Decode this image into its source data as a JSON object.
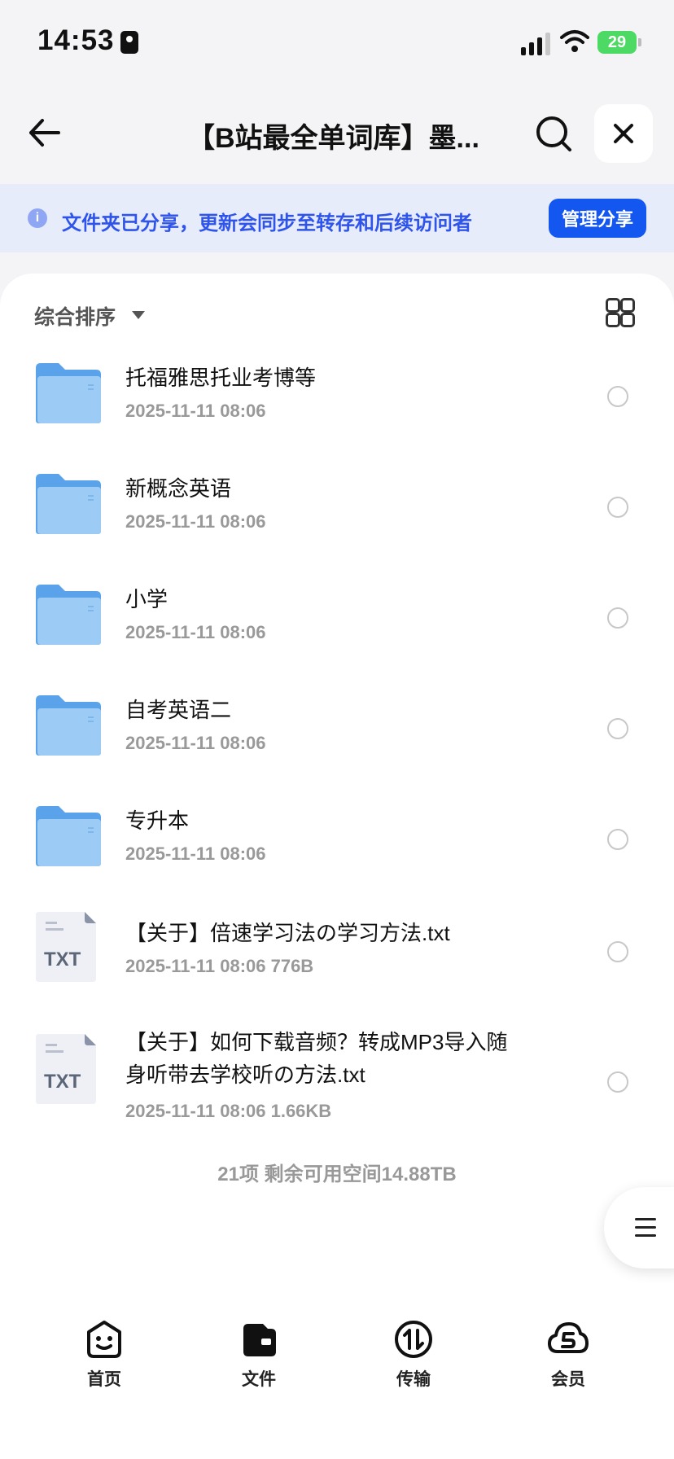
{
  "status_bar": {
    "time": "14:53",
    "battery": "29"
  },
  "header": {
    "title": "【B站最全单词库】墨..."
  },
  "banner": {
    "text": "文件夹已分享，更新会同步至转存和后续访问者",
    "manage_label": "管理分享"
  },
  "sort": {
    "label": "综合排序"
  },
  "files": [
    {
      "type": "folder",
      "name": "托福雅思托业考博等",
      "meta": "2025-11-11 08:06"
    },
    {
      "type": "folder",
      "name": "新概念英语",
      "meta": "2025-11-11 08:06"
    },
    {
      "type": "folder",
      "name": "小学",
      "meta": "2025-11-11 08:06"
    },
    {
      "type": "folder",
      "name": "自考英语二",
      "meta": "2025-11-11 08:06"
    },
    {
      "type": "folder",
      "name": "专升本",
      "meta": "2025-11-11 08:06"
    },
    {
      "type": "txt",
      "icon_label": "TXT",
      "name": "【关于】倍速学习法の学习方法.txt",
      "meta": "2025-11-11 08:06  776B"
    },
    {
      "type": "txt",
      "icon_label": "TXT",
      "name_line1": "【关于】如何下载音频？转成MP3导入随",
      "name_line2": "身听带去学校听の方法.txt",
      "meta": "2025-11-11 08:06  1.66KB"
    }
  ],
  "footer": {
    "summary": "21项 剩余可用空间14.88TB"
  },
  "nav": [
    {
      "label": "首页",
      "icon": "smile-face-icon"
    },
    {
      "label": "文件",
      "icon": "wallet-folder-icon"
    },
    {
      "label": "传输",
      "icon": "transfer-icon"
    },
    {
      "label": "会员",
      "icon": "cloud-vip-icon"
    }
  ],
  "colors": {
    "accent": "#1456f0",
    "banner_bg": "#e7ecfb",
    "folder": "#6aaef0"
  }
}
